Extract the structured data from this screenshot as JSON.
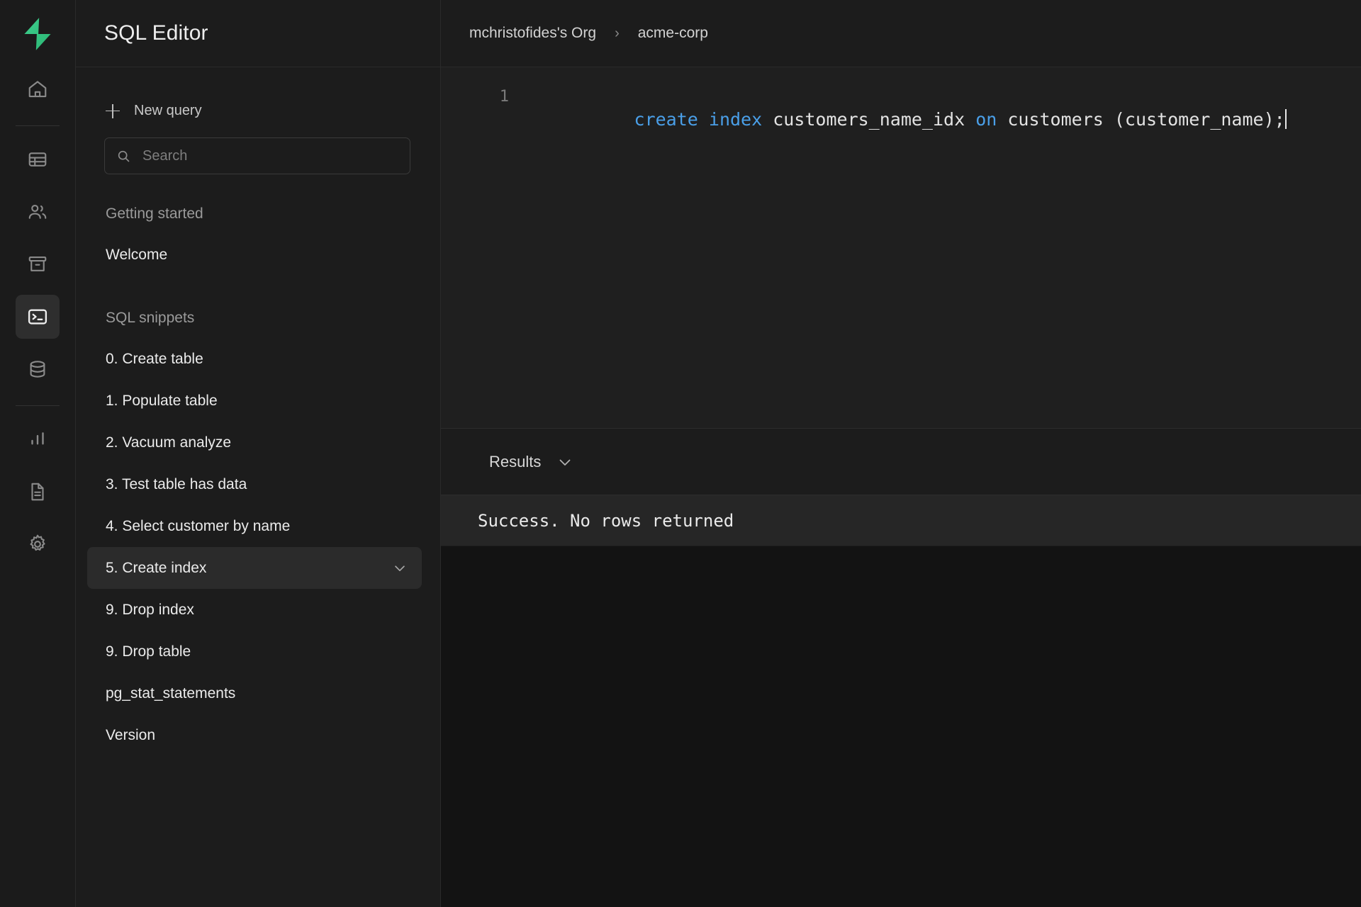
{
  "rail": {
    "logo": "supabase-logo",
    "items": [
      {
        "name": "home",
        "icon": "home-icon",
        "active": false
      },
      {
        "name": "table-editor",
        "icon": "table-icon",
        "active": false
      },
      {
        "name": "authentication",
        "icon": "users-icon",
        "active": false
      },
      {
        "name": "storage",
        "icon": "archive-icon",
        "active": false
      },
      {
        "name": "sql-editor",
        "icon": "terminal-icon",
        "active": true
      },
      {
        "name": "database",
        "icon": "database-icon",
        "active": false
      },
      {
        "name": "reports",
        "icon": "bar-chart-icon",
        "active": false
      },
      {
        "name": "logs",
        "icon": "document-icon",
        "active": false
      },
      {
        "name": "settings",
        "icon": "gear-icon",
        "active": false
      }
    ]
  },
  "panel": {
    "title": "SQL Editor",
    "new_query_label": "New query",
    "new_query_icon": "plus-icon",
    "search": {
      "icon": "search-icon",
      "value": "",
      "placeholder": "Search"
    },
    "sections": [
      {
        "label": "Getting started",
        "items": [
          {
            "label": "Welcome",
            "selected": false,
            "chevron": false
          }
        ]
      },
      {
        "label": "SQL snippets",
        "items": [
          {
            "label": "0. Create table",
            "selected": false,
            "chevron": false
          },
          {
            "label": "1. Populate table",
            "selected": false,
            "chevron": false
          },
          {
            "label": "2. Vacuum analyze",
            "selected": false,
            "chevron": false
          },
          {
            "label": "3. Test table has data",
            "selected": false,
            "chevron": false
          },
          {
            "label": "4. Select customer by name",
            "selected": false,
            "chevron": false
          },
          {
            "label": "5. Create index",
            "selected": true,
            "chevron": true
          },
          {
            "label": "9. Drop index",
            "selected": false,
            "chevron": false
          },
          {
            "label": "9. Drop table",
            "selected": false,
            "chevron": false
          },
          {
            "label": "pg_stat_statements",
            "selected": false,
            "chevron": false
          },
          {
            "label": "Version",
            "selected": false,
            "chevron": false
          }
        ]
      }
    ]
  },
  "breadcrumb": {
    "org": "mchristofides's Org",
    "separator": "›",
    "project": "acme-corp"
  },
  "editor": {
    "line_number": "1",
    "tokens": [
      {
        "text": "create",
        "type": "keyword"
      },
      {
        "text": " ",
        "type": "plain"
      },
      {
        "text": "index",
        "type": "keyword"
      },
      {
        "text": " customers_name_idx ",
        "type": "plain"
      },
      {
        "text": "on",
        "type": "keyword"
      },
      {
        "text": " customers (customer_name);",
        "type": "plain"
      }
    ],
    "full_text": "create index customers_name_idx on customers (customer_name);",
    "cursor_visible": true
  },
  "results": {
    "label": "Results",
    "chevron_icon": "chevron-down-icon",
    "message": "Success. No rows returned"
  },
  "colors": {
    "accent_green": "#3ecf8e",
    "keyword_blue": "#4a9fe8",
    "panel_bg": "#1c1c1c",
    "editor_bg": "#1f1f1f",
    "selected_bg": "#2b2b2b",
    "results_row_bg": "#262626"
  }
}
